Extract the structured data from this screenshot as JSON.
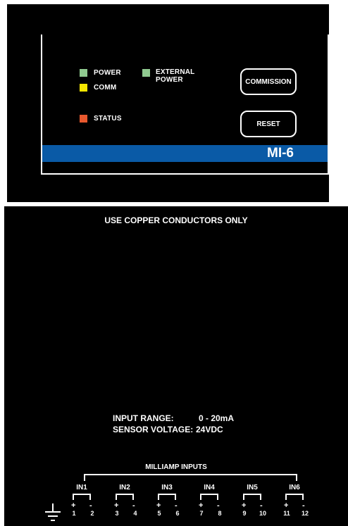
{
  "panel": {
    "colors": {
      "background": "#000000",
      "band": "#0a5aa6",
      "power_led": "#8fc98f",
      "comm_led": "#f5e600",
      "external_power_led": "#8fc98f",
      "status_led": "#e8582e"
    },
    "indicators": {
      "power": "POWER",
      "comm": "COMM",
      "external_power_line1": "EXTERNAL",
      "external_power_line2": "POWER",
      "status": "STATUS"
    },
    "buttons": {
      "commission": "COMMISSION",
      "reset": "RESET"
    },
    "model": "MI-6"
  },
  "terminal": {
    "warning": "USE COPPER CONDUCTORS ONLY",
    "input_range_label": "INPUT RANGE:",
    "input_range_value": "0 - 20mA",
    "sensor_voltage_label": "SENSOR VOLTAGE:",
    "sensor_voltage_value": "24VDC",
    "inputs_title": "MILLIAMP INPUTS",
    "channels": [
      {
        "name": "IN1",
        "plus": "+",
        "minus": "-",
        "t1": "1",
        "t2": "2"
      },
      {
        "name": "IN2",
        "plus": "+",
        "minus": "-",
        "t1": "3",
        "t2": "4"
      },
      {
        "name": "IN3",
        "plus": "+",
        "minus": "-",
        "t1": "5",
        "t2": "6"
      },
      {
        "name": "IN4",
        "plus": "+",
        "minus": "-",
        "t1": "7",
        "t2": "8"
      },
      {
        "name": "IN5",
        "plus": "+",
        "minus": "-",
        "t1": "9",
        "t2": "10"
      },
      {
        "name": "IN6",
        "plus": "+",
        "minus": "-",
        "t1": "11",
        "t2": "12"
      }
    ]
  }
}
